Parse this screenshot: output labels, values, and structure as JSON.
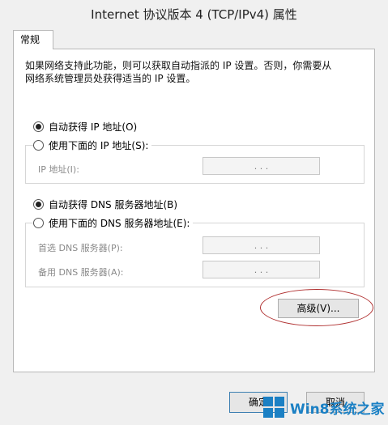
{
  "window": {
    "title": "Internet 协议版本 4 (TCP/IPv4) 属性"
  },
  "tab": {
    "label": "常规"
  },
  "description": {
    "line1": "如果网络支持此功能，则可以获取自动指派的 IP 设置。否则，你需要从",
    "line2": "网络系统管理员处获得适当的 IP 设置。"
  },
  "ip": {
    "auto_label": "自动获得 IP 地址(O)",
    "manual_label": "使用下面的 IP 地址(S):",
    "auto_selected": true,
    "address_label": "IP 地址(I):",
    "address_value": ". . ."
  },
  "dns": {
    "auto_label": "自动获得 DNS 服务器地址(B)",
    "manual_label": "使用下面的 DNS 服务器地址(E):",
    "auto_selected": true,
    "preferred_label": "首选 DNS 服务器(P):",
    "preferred_value": ". . .",
    "alternate_label": "备用 DNS 服务器(A):",
    "alternate_value": ". . ."
  },
  "buttons": {
    "advanced": "高级(V)...",
    "ok": "确定",
    "cancel": "取消"
  },
  "watermark": {
    "text": "Win8系统之家",
    "color": "#1b80c4"
  }
}
